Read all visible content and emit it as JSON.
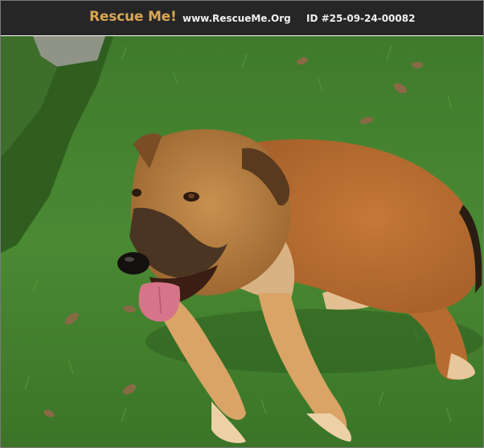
{
  "header": {
    "brand": "Rescue Me!",
    "site_url": "www.RescueMe.Org",
    "listing_id": "ID #25-09-24-00082"
  },
  "colors": {
    "header_bg": "#262626",
    "brand_accent": "#d9a654",
    "header_text": "#f0f0f0"
  },
  "photo": {
    "subject": "dog-lying-on-grass"
  }
}
